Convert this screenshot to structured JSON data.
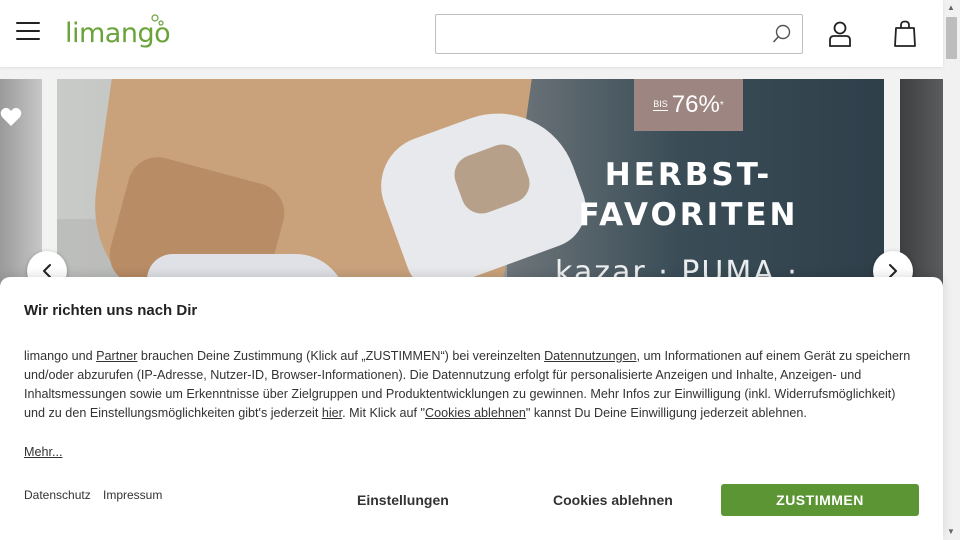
{
  "header": {
    "logo_text": "limango",
    "search": {
      "value": "",
      "placeholder": ""
    }
  },
  "banner": {
    "badge_prefix": "BIS",
    "badge_value": "76%",
    "badge_suffix": "*",
    "headline_line1": "HERBST-",
    "headline_line2": "FAVORITEN",
    "brands": "kazar · PUMA · HYM"
  },
  "consent": {
    "title": "Wir richten uns nach Dir",
    "text_part1": "limango und ",
    "link_partner": "Partner",
    "text_part2": " brauchen Deine Zustimmung (Klick auf „ZUSTIMMEN“) bei vereinzelten ",
    "link_datennutzungen": "Datennutzungen",
    "text_part3": ", um Informationen auf einem Gerät zu speichern und/oder abzurufen (IP-Adresse, Nutzer-ID, Browser-Informationen). Die Datennutzung erfolgt für personalisierte Anzeigen und Inhalte, Anzeigen- und Inhaltsmessungen sowie um Erkenntnisse über Zielgruppen und Produktentwicklungen zu gewinnen. Mehr Infos zur Einwilligung (inkl. Widerrufsmöglichkeit) und zu den Einstellungsmöglichkeiten gibt's jederzeit ",
    "link_hier": "hier",
    "text_part4": ". Mit Klick auf \"",
    "link_cookies_ablehnen": "Cookies ablehnen",
    "text_part5": "\" kannst Du Deine Einwilligung jederzeit ablehnen.",
    "mehr": "Mehr...",
    "datenschutz": "Datenschutz",
    "impressum": "Impressum",
    "settings_button": "Einstellungen",
    "reject_button": "Cookies ablehnen",
    "accept_button": "ZUSTIMMEN"
  },
  "colors": {
    "brand_green": "#6aa33a",
    "accept_green": "#5c9634",
    "badge_bg": "#9d8581"
  }
}
